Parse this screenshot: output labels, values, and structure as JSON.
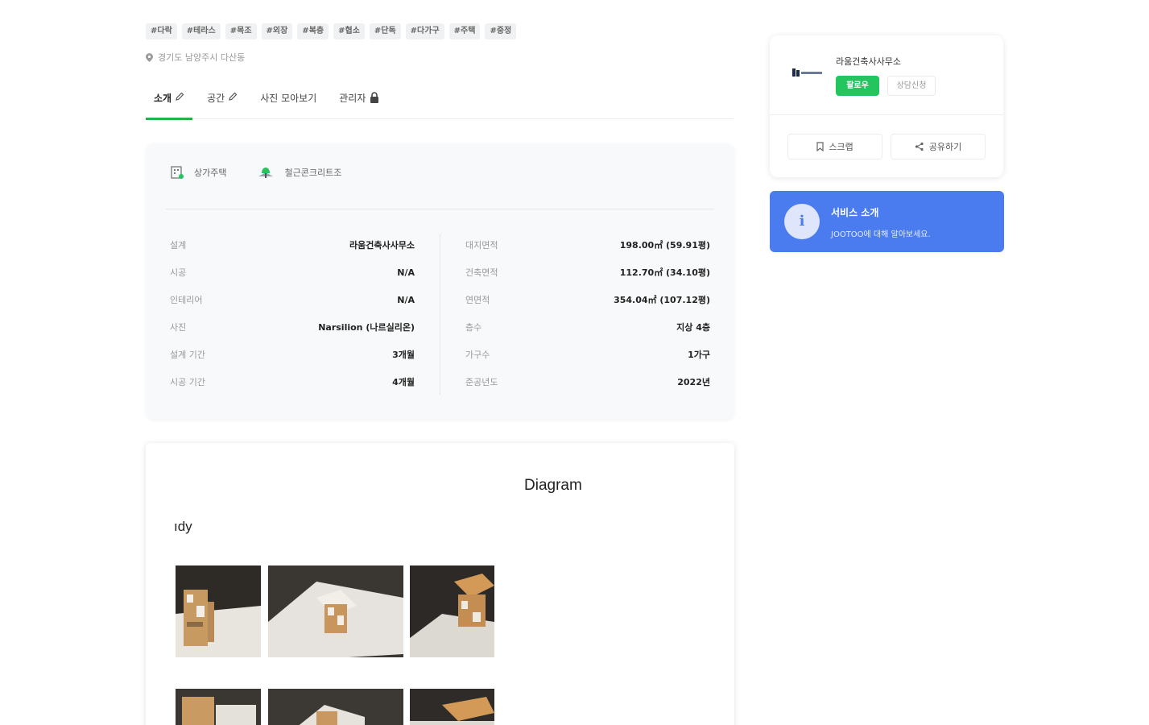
{
  "tags": [
    "#다락",
    "#테라스",
    "#목조",
    "#외장",
    "#복층",
    "#협소",
    "#단독",
    "#다가구",
    "#주택",
    "#중정"
  ],
  "location": "경기도 남양주시 다산동",
  "tabs": [
    {
      "label": "소개",
      "icon": "pencil-icon"
    },
    {
      "label": "공간",
      "icon": "pencil-icon"
    },
    {
      "label": "사진 모아보기",
      "icon": ""
    },
    {
      "label": "관리자",
      "icon": "lock-icon"
    }
  ],
  "categories": [
    {
      "label": "상가주택",
      "icon": "building-icon"
    },
    {
      "label": "철근콘크리트조",
      "icon": "structure-icon"
    }
  ],
  "specs_left": [
    {
      "key": "설계",
      "value": "라움건축사사무소"
    },
    {
      "key": "시공",
      "value": "N/A"
    },
    {
      "key": "인테리어",
      "value": "N/A"
    },
    {
      "key": "사진",
      "value": "Narsilion (나르실리온)"
    },
    {
      "key": "설계 기간",
      "value": "3개월"
    },
    {
      "key": "시공 기간",
      "value": "4개월"
    }
  ],
  "specs_right": [
    {
      "key": "대지면적",
      "value": "198.00㎡ (59.91평)"
    },
    {
      "key": "건축면적",
      "value": "112.70㎡ (34.10평)"
    },
    {
      "key": "연면적",
      "value": "354.04㎡ (107.12평)"
    },
    {
      "key": "층수",
      "value": "지상 4층"
    },
    {
      "key": "가구수",
      "value": "1가구"
    },
    {
      "key": "준공년도",
      "value": "2022년"
    }
  ],
  "diagram": {
    "title": "Diagram",
    "subtitle": "ıdy"
  },
  "profile": {
    "firm_name": "라움건축사사무소",
    "follow_label": "팔로우",
    "consult_label": "상담신청",
    "scrap_label": "스크랩",
    "share_label": "공유하기"
  },
  "service": {
    "icon": "i",
    "title": "서비스 소개",
    "description": "JOOTOO에 대해 알아보세요."
  },
  "colors": {
    "accent_green": "#22c55e",
    "service_blue": "#4a7cf0"
  }
}
